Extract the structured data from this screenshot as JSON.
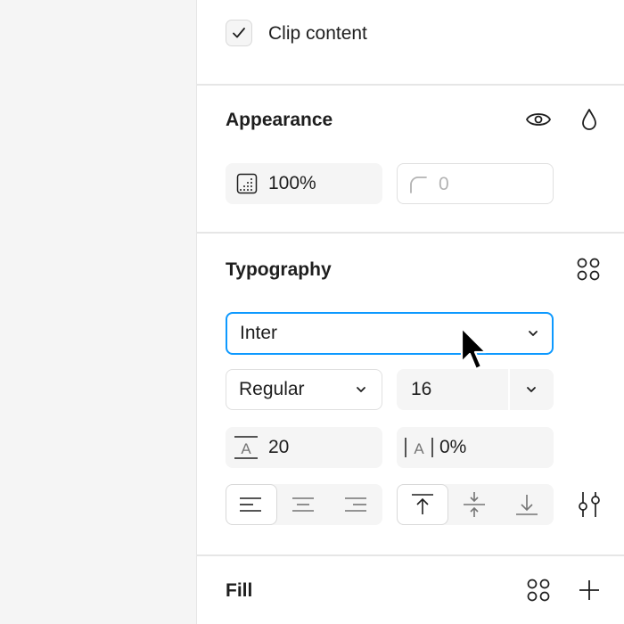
{
  "frame": {
    "clip_content_label": "Clip content",
    "clip_content_checked": true
  },
  "appearance": {
    "title": "Appearance",
    "opacity_value": "100%",
    "corner_radius_value": "0",
    "icons": {
      "visibility": "eye-icon",
      "blend_mode": "drop-icon",
      "opacity": "opacity-grid-icon",
      "radius": "corner-radius-icon"
    }
  },
  "typography": {
    "title": "Typography",
    "font_family": "Inter",
    "font_weight": "Regular",
    "font_size": "16",
    "line_height": "20",
    "letter_spacing": "0%",
    "text_align_options": [
      "left",
      "center",
      "right"
    ],
    "text_align_selected": "left",
    "vertical_align_options": [
      "top",
      "middle",
      "bottom"
    ],
    "vertical_align_selected": "top",
    "icons": {
      "styles": "styles-grid-icon",
      "settings": "sliders-icon"
    }
  },
  "fill": {
    "title": "Fill",
    "icons": {
      "styles": "styles-grid-icon",
      "add": "plus-icon"
    }
  },
  "colors": {
    "accent": "#0d99ff",
    "panel_bg": "#ffffff",
    "canvas_bg": "#f5f5f5",
    "field_bg": "#f5f5f5",
    "text": "#1e1e1e",
    "muted": "#b3b3b3"
  }
}
